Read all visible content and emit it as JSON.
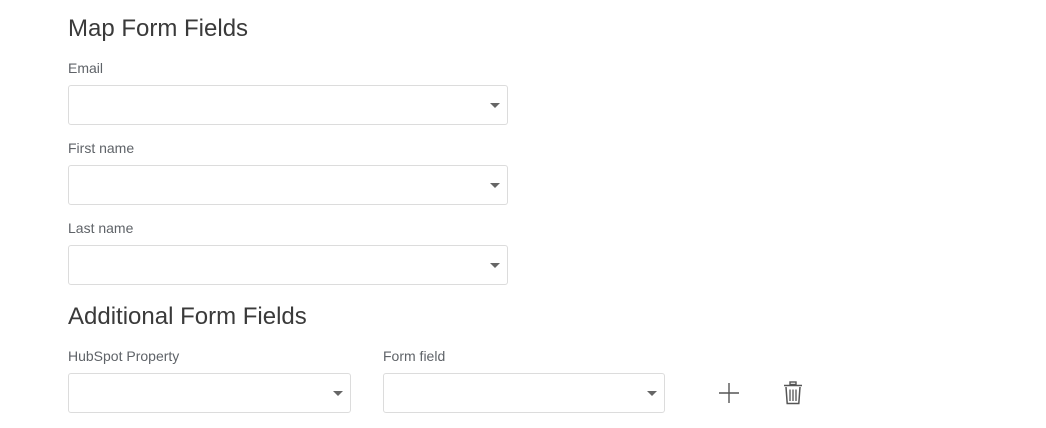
{
  "map_section": {
    "title": "Map Form Fields",
    "fields": [
      {
        "label": "Email",
        "value": ""
      },
      {
        "label": "First name",
        "value": ""
      },
      {
        "label": "Last name",
        "value": ""
      }
    ]
  },
  "additional_section": {
    "title": "Additional Form Fields",
    "hubspot_property": {
      "label": "HubSpot Property",
      "value": ""
    },
    "form_field": {
      "label": "Form field",
      "value": ""
    },
    "actions": {
      "add_icon": "plus-icon",
      "delete_icon": "trash-icon"
    }
  },
  "colors": {
    "border": "#dcdcdc",
    "label": "#5f6368",
    "title": "#3a3a3a",
    "icon": "#555555"
  }
}
